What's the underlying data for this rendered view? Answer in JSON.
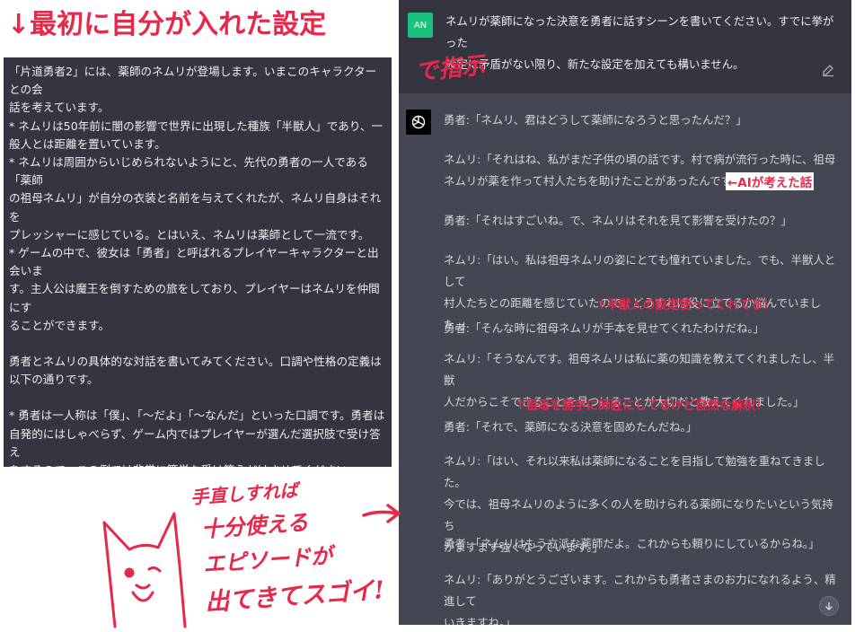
{
  "heading": "↓最初に自分が入れた設定",
  "left_panel": {
    "paragraphs": [
      "「片道勇者2」には、薬師のネムリが登場します。いまこのキャラクターとの会\n話を考えています。\n* ネムリは50年前に闇の影響で世界に出現した種族「半獣人」であり、一\n般人とは距離を置いています。\n* ネムリは周囲からいじめられないようにと、先代の勇者の一人である「薬師\nの祖母ネムリ」が自分の衣装と名前を与えてくれたが、ネムリ自身はそれを\nプレッシャーに感じている。とはいえ、ネムリは薬師として一流です。\n* ゲームの中で、彼女は「勇者」と呼ばれるプレイヤーキャラクターと出会いま\nす。主人公は魔王を倒すための旅をしており、プレイヤーはネムリを仲間にす\nることができます。",
      "勇者とネムリの具体的な対話を書いてみてください。口調や性格の定義は\n以下の通りです。",
      "* 勇者は一人称は「僕」、「～だよ」「～なんだ」といった口調です。勇者は\n自発的にはしゃべらず、ゲーム内ではプレイヤーが選んだ選択肢で受け答え\nをするので、この例では非常に簡単な受け答えだけさせてください。\n* ネムリは控えめで「～なんです」「～なんですね」と丁寧なしゃべり方をしま\nす。テンションが上がったり驚いたりすると「そうなんですか！？」「私、ネムリ\nの実が大好きなんです！」といった元気な言い方もします。\n* ネムリはナユタの実という果物が大好物です。"
    ]
  },
  "chat": {
    "user_avatar": "AN",
    "user_prompt": "ネムリが薬師になった決意を勇者に話すシーンを書いてください。すでに挙がった\n設定に矛盾がない限り、新たな設定を加えても構いません。",
    "assistant_lines": [
      "勇者:「ネムリ、君はどうして薬師になろうと思ったんだ？」",
      "ネムリ:「それはね、私がまだ子供の頃の話です。村で病が流行った時に、祖母\nネムリが薬を作って村人たちを助けたことがあったんです。」",
      "勇者:「それはすごいね。で、ネムリはそれを見て影響を受けたの？」",
      "ネムリ:「はい。私は祖母ネムリの姿にとても憧れていました。でも、半獣人として\n村人たちとの距離を感じていたので、どうすれば役に立てるか悩んでいました。」",
      "勇者:「そんな時に祖母ネムリが手本を見せてくれたわけだね。」",
      "ネムリ:「そうなんです。祖母ネムリは私に薬の知識を教えてくれましたし、半獣\n人だからこそできることを見つけることが大切だと教えてくれました。」",
      "勇者:「それで、薬師になる決意を固めたんだね。」",
      "ネムリ:「はい、それ以来私は薬師になることを目指して勉強を重ねてきました。\n今では、祖母ネムリのように多くの人を助けられる薬師になりたいという気持ち\nがますます強くなっています。」",
      "勇者:「ネムリはもう立派な薬師だよ。これからも頼りにしているからね。」",
      "ネムリ:「ありがとうございます。これからも勇者さまのお力になれるよう、精進して\nいきますね。」"
    ]
  },
  "annotations": {
    "instruction": "で指示",
    "ai_idea": "←AIが考えた話",
    "half_beast": "↑半獣人の設定使ってくれてる！",
    "grandma": "↑祖母を勝手に師匠にしてるけど自然な解釈！",
    "cat_note_lines": [
      "手直しすれば",
      "十分使える",
      "エピソードが",
      "出てきてスゴイ!"
    ]
  },
  "colors": {
    "accent_red": "#e8284a",
    "panel_dark": "#343541",
    "assistant_bg": "#444654",
    "user_avatar_bg": "#19c37d"
  }
}
